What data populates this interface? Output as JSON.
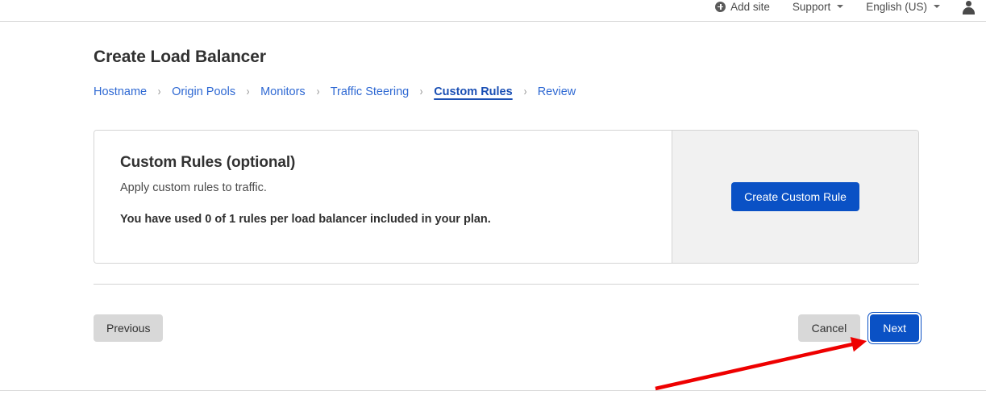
{
  "topbar": {
    "items": [
      {
        "label": "Add site",
        "icon": "plus-circle-icon",
        "has_caret": false
      },
      {
        "label": "Support",
        "icon": null,
        "has_caret": true
      },
      {
        "label": "English (US)",
        "icon": null,
        "has_caret": true
      }
    ],
    "avatar_icon": "user-avatar-icon"
  },
  "page": {
    "title": "Create Load Balancer"
  },
  "breadcrumb": {
    "separator": "›",
    "steps": [
      {
        "label": "Hostname",
        "active": false
      },
      {
        "label": "Origin Pools",
        "active": false
      },
      {
        "label": "Monitors",
        "active": false
      },
      {
        "label": "Traffic Steering",
        "active": false
      },
      {
        "label": "Custom Rules",
        "active": true
      },
      {
        "label": "Review",
        "active": false
      }
    ]
  },
  "card": {
    "heading": "Custom Rules (optional)",
    "subtitle": "Apply custom rules to traffic.",
    "quota_text": "You have used 0 of 1 rules per load balancer included in your plan.",
    "action_label": "Create Custom Rule"
  },
  "footer": {
    "previous_label": "Previous",
    "cancel_label": "Cancel",
    "next_label": "Next"
  },
  "colors": {
    "primary_blue": "#0a51c5",
    "link_blue": "#2f69d3",
    "active_blue": "#1a4fb4",
    "panel_gray": "#f1f1f1",
    "secondary_gray": "#d8d8d8",
    "border_gray": "#d4d4d4",
    "annotation_red": "#ee0000"
  }
}
